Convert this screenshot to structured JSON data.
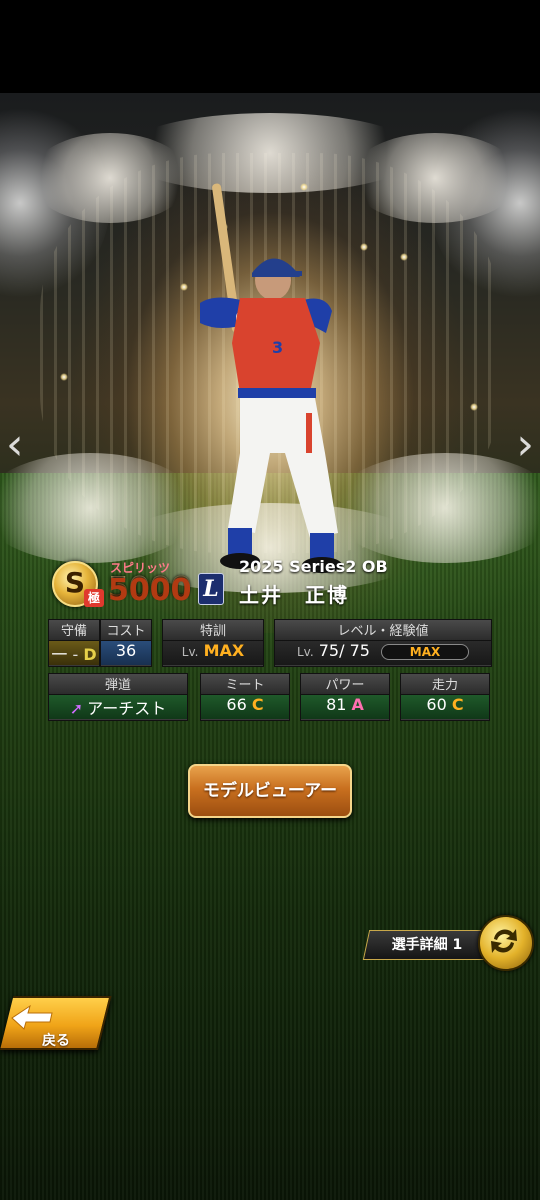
{
  "player": {
    "spirits_label": "スピリッツ",
    "spirits_value": "5000",
    "rank_letter": "S",
    "rank_kanji": "極",
    "team_letter": "L",
    "series": "2025 Series2 OB",
    "name": "土井　正博"
  },
  "stats": {
    "position": {
      "label": "守備",
      "value": "一",
      "grade": "D"
    },
    "cost": {
      "label": "コスト",
      "value": "36"
    },
    "training": {
      "label": "特訓",
      "lv": "Lv.",
      "value": "MAX"
    },
    "level": {
      "label": "レベル・経験値",
      "lv": "Lv.",
      "current": "75",
      "sep": "/",
      "max": "75",
      "exp_text": "MAX"
    },
    "trajectory": {
      "label": "弾道",
      "value": "アーチスト"
    },
    "meet": {
      "label": "ミート",
      "value": "66",
      "grade": "C"
    },
    "power": {
      "label": "パワー",
      "value": "81",
      "grade": "A"
    },
    "speed": {
      "label": "走力",
      "value": "60",
      "grade": "C"
    }
  },
  "buttons": {
    "model_viewer": "モデルビューアー",
    "player_detail": "選手詳細 1",
    "back": "戻る"
  },
  "icons": {
    "prev": "chevron-left-icon",
    "next": "chevron-right-icon",
    "switch": "swap-arrows-icon",
    "back": "back-arrow-icon"
  },
  "colors": {
    "accent_orange": "#ffb020",
    "button_orange": "#c9701f",
    "grade_a": "#ff6fb0"
  }
}
